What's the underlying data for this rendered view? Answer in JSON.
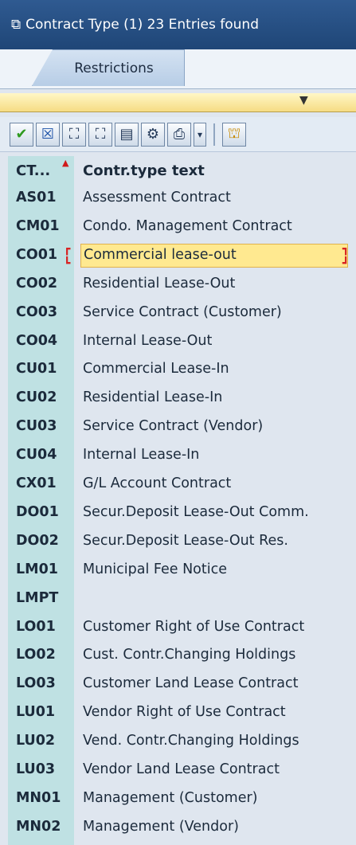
{
  "window": {
    "title": "Contract Type (1)   23 Entries found"
  },
  "tabs": [
    {
      "label": "Restrictions"
    }
  ],
  "toolbar": {
    "buttons": [
      {
        "icon": "check-icon",
        "glyph": "✔"
      },
      {
        "icon": "cancel-icon",
        "glyph": "☒"
      },
      {
        "icon": "find-icon",
        "glyph": "⛶"
      },
      {
        "icon": "find-next-icon",
        "glyph": "⛶"
      },
      {
        "icon": "export-icon",
        "glyph": "▤"
      },
      {
        "icon": "info-icon",
        "glyph": "⚙"
      },
      {
        "icon": "print-icon",
        "glyph": "⎙"
      },
      {
        "icon": "dropdown-icon",
        "glyph": "▾"
      },
      {
        "icon": "pin-icon",
        "glyph": "⛫"
      }
    ]
  },
  "table": {
    "columns": {
      "ct": "CT...",
      "text": "Contr.type text"
    },
    "selected_row": 2,
    "rows": [
      {
        "ct": "AS01",
        "text": "Assessment Contract"
      },
      {
        "ct": "CM01",
        "text": "Condo. Management Contract"
      },
      {
        "ct": "CO01",
        "text": "Commercial lease-out"
      },
      {
        "ct": "CO02",
        "text": "Residential Lease-Out"
      },
      {
        "ct": "CO03",
        "text": "Service Contract (Customer)"
      },
      {
        "ct": "CO04",
        "text": "Internal Lease-Out"
      },
      {
        "ct": "CU01",
        "text": "Commercial Lease-In"
      },
      {
        "ct": "CU02",
        "text": "Residential Lease-In"
      },
      {
        "ct": "CU03",
        "text": "Service Contract (Vendor)"
      },
      {
        "ct": "CU04",
        "text": "Internal Lease-In"
      },
      {
        "ct": "CX01",
        "text": "G/L Account Contract"
      },
      {
        "ct": "DO01",
        "text": "Secur.Deposit Lease-Out Comm."
      },
      {
        "ct": "DO02",
        "text": "Secur.Deposit Lease-Out Res."
      },
      {
        "ct": "LM01",
        "text": "Municipal Fee Notice"
      },
      {
        "ct": "LMPT",
        "text": ""
      },
      {
        "ct": "LO01",
        "text": "Customer Right of Use Contract"
      },
      {
        "ct": "LO02",
        "text": "Cust. Contr.Changing Holdings"
      },
      {
        "ct": "LO03",
        "text": "Customer Land Lease Contract"
      },
      {
        "ct": "LU01",
        "text": "Vendor Right of Use Contract"
      },
      {
        "ct": "LU02",
        "text": "Vend. Contr.Changing Holdings"
      },
      {
        "ct": "LU03",
        "text": "Vendor Land Lease Contract"
      },
      {
        "ct": "MN01",
        "text": "Management (Customer)"
      },
      {
        "ct": "MN02",
        "text": "Management (Vendor)"
      }
    ]
  }
}
